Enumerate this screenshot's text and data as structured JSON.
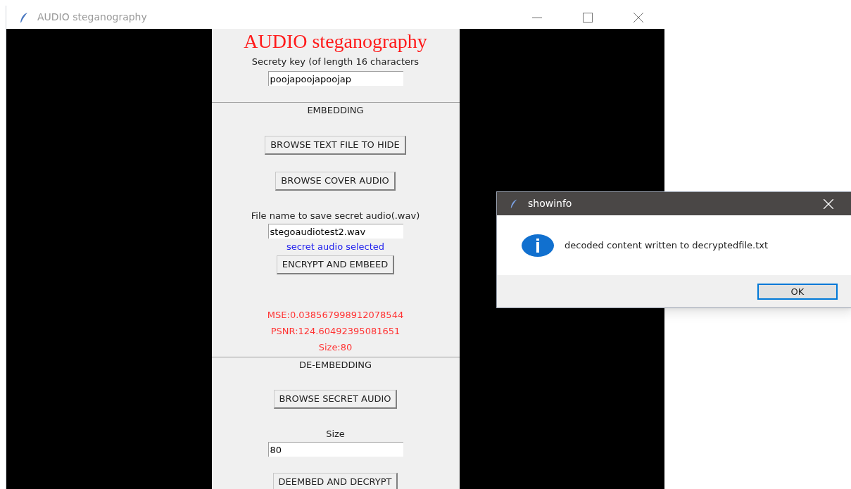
{
  "window": {
    "title": "AUDIO steganography"
  },
  "panel": [
    {
      "kind": "title",
      "text": "AUDIO steganography"
    },
    {
      "kind": "label",
      "text": "Secrety key (of length 16 characters"
    },
    {
      "kind": "input",
      "value": "poojapoojapoojap"
    },
    {
      "kind": "divider"
    },
    {
      "kind": "label",
      "text": "EMBEDDING"
    },
    {
      "kind": "button",
      "text": "BROWSE TEXT FILE TO HIDE"
    },
    {
      "kind": "button",
      "text": "BROWSE COVER AUDIO"
    },
    {
      "kind": "label",
      "text": "File name to save secret audio(.wav)"
    },
    {
      "kind": "input",
      "value": "stegoaudiotest2.wav"
    },
    {
      "kind": "info",
      "text": "secret audio selected"
    },
    {
      "kind": "button",
      "text": "ENCRYPT AND EMBEED"
    },
    {
      "kind": "result",
      "text": "MSE:0.038567998912078544"
    },
    {
      "kind": "result",
      "text": "PSNR:124.60492395081651"
    },
    {
      "kind": "result",
      "text": "Size:80"
    },
    {
      "kind": "divider"
    },
    {
      "kind": "label",
      "text": "DE-EMBEDDING"
    },
    {
      "kind": "button",
      "text": "BROWSE SECRET AUDIO"
    },
    {
      "kind": "label",
      "text": "Size"
    },
    {
      "kind": "input",
      "value": "80"
    },
    {
      "kind": "button",
      "text": "DEEMBED AND DECRYPT"
    }
  ],
  "dialog": {
    "title": "showinfo",
    "message": "decoded content written to decryptedfile.txt",
    "button": "OK"
  }
}
